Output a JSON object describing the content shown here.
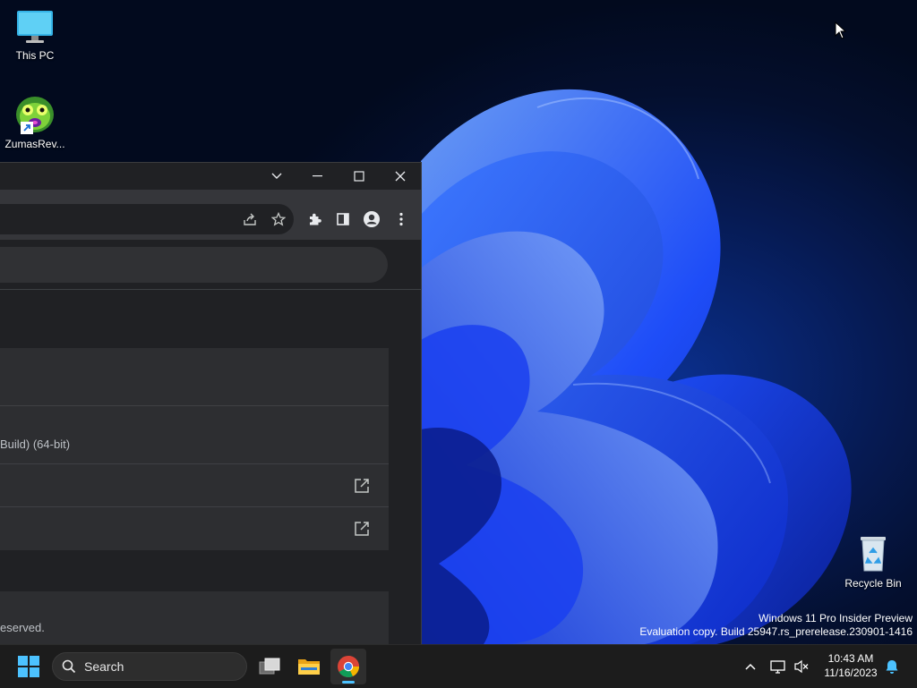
{
  "desktop": {
    "icons": [
      {
        "label": "This PC"
      },
      {
        "label": "ZumasRev..."
      },
      {
        "label": "Recycle Bin"
      }
    ],
    "watermark": {
      "line1": "Windows 11 Pro Insider Preview",
      "line2": "Evaluation copy. Build 25947.rs_prerelease.230901-1416"
    }
  },
  "browser": {
    "content": {
      "version_text": "Build) (64-bit)",
      "copyright_text": "eserved."
    }
  },
  "taskbar": {
    "search_label": "Search",
    "time": "10:43 AM",
    "date": "11/16/2023"
  },
  "colors": {
    "accent": "#4cc2ff",
    "window_bg": "#202124",
    "toolbar_bg": "#35363a"
  }
}
